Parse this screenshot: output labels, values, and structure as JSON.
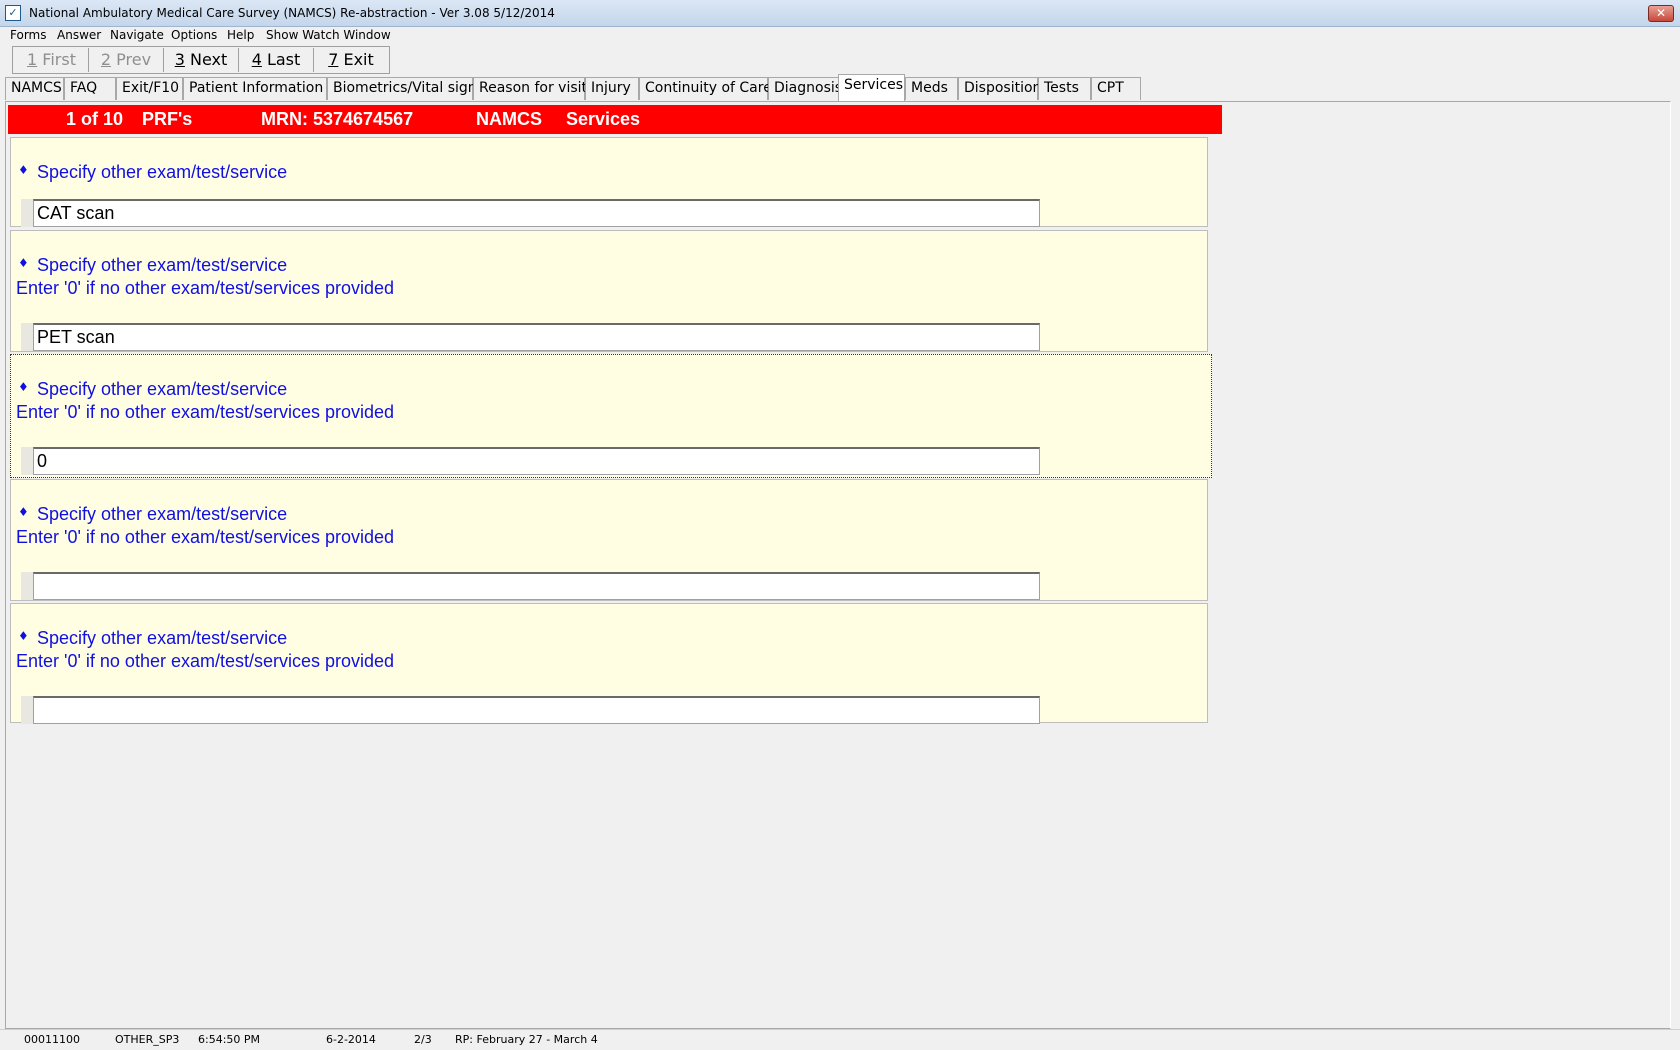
{
  "window": {
    "title": "National Ambulatory Medical Care Survey (NAMCS) Re-abstraction  - Ver 3.08 5/12/2014",
    "close_glyph": "✕"
  },
  "menu": [
    "Forms",
    "Answer",
    "Navigate",
    "Options",
    "Help",
    "Show Watch Window"
  ],
  "nav_buttons": [
    {
      "key": "1",
      "label": " First",
      "enabled": false
    },
    {
      "key": "2",
      "label": " Prev",
      "enabled": false
    },
    {
      "key": "3",
      "label": " Next",
      "enabled": true
    },
    {
      "key": "4",
      "label": " Last",
      "enabled": true
    },
    {
      "key": "7",
      "label": " Exit",
      "enabled": true
    }
  ],
  "tabs": [
    "NAMCS",
    "FAQ",
    "Exit/F10",
    "Patient Information",
    "Biometrics/Vital signs",
    "Reason for visit",
    "Injury",
    "Continuity of Care",
    "Diagnosis",
    "Services",
    "Meds",
    "Disposition",
    "Tests",
    "CPT"
  ],
  "active_tab": "Services",
  "banner": {
    "record": "1 of 10",
    "form": "PRF's",
    "mrn": "MRN: 5374674567",
    "survey": "NAMCS",
    "section": "Services",
    "color": "#ff0000"
  },
  "questions": [
    {
      "bullet": "♦",
      "prompt": "Specify other exam/test/service",
      "hint": "",
      "value": "CAT scan"
    },
    {
      "bullet": "♦",
      "prompt": "Specify other exam/test/service",
      "hint": "Enter '0' if no other exam/test/services provided",
      "value": "PET scan"
    },
    {
      "bullet": "♦",
      "prompt": "Specify other exam/test/service",
      "hint": "Enter '0' if no other exam/test/services provided",
      "value": "0"
    },
    {
      "bullet": "♦",
      "prompt": "Specify other exam/test/service",
      "hint": "Enter '0' if no other exam/test/services provided",
      "value": ""
    },
    {
      "bullet": "♦",
      "prompt": "Specify other exam/test/service",
      "hint": "Enter '0' if no other exam/test/services provided",
      "value": ""
    }
  ],
  "status": {
    "code": "00011100",
    "field": "OTHER_SP3",
    "time": "6:54:50 PM",
    "date": "6-2-2014",
    "page": "2/3",
    "period": "RP: February 27 - March 4"
  },
  "colors": {
    "question_text": "#1010e0",
    "panel_bg": "#fffee2"
  }
}
